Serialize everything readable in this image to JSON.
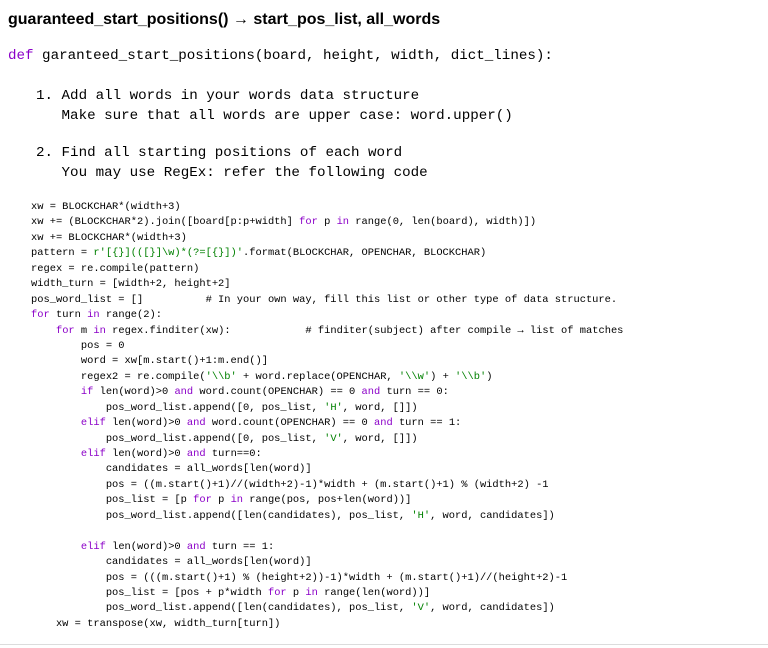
{
  "document": {
    "heading": "guaranteed_start_positions() → start_pos_list, all_words",
    "def_kw": "def",
    "def_signature": " garanteed_start_positions(board, height, width, dict_lines):",
    "steps": [
      {
        "line1": "1. Add all words in your words data structure",
        "line2": "   Make sure that all words are upper case: word.upper()"
      },
      {
        "line1": "2. Find all starting positions of each word",
        "line2": "   You may use RegEx: refer the following code"
      }
    ],
    "code_lines": [
      [
        {
          "t": "xw = BLOCKCHAR*(width+3)"
        }
      ],
      [
        {
          "t": "xw += (BLOCKCHAR*2).join([board[p:p+width] "
        },
        {
          "t": "for",
          "c": "kw"
        },
        {
          "t": " p "
        },
        {
          "t": "in",
          "c": "kw"
        },
        {
          "t": " range(0, len(board), width)])"
        }
      ],
      [
        {
          "t": "xw += BLOCKCHAR*(width+3)"
        }
      ],
      [
        {
          "t": "pattern = "
        },
        {
          "t": "r'[{}](([}]\\w)*(?=[{}])'",
          "c": "str"
        },
        {
          "t": ".format(BLOCKCHAR, OPENCHAR, BLOCKCHAR)"
        }
      ],
      [
        {
          "t": "regex = re.compile(pattern)"
        }
      ],
      [
        {
          "t": "width_turn = [width+2, height+2]"
        }
      ],
      [
        {
          "t": "pos_word_list = []          # In your own way, fill this list or other type of data structure."
        }
      ],
      [
        {
          "t": "for",
          "c": "kw"
        },
        {
          "t": " turn "
        },
        {
          "t": "in",
          "c": "kw"
        },
        {
          "t": " range(2):"
        }
      ],
      [
        {
          "t": "    "
        },
        {
          "t": "for",
          "c": "kw"
        },
        {
          "t": " m "
        },
        {
          "t": "in",
          "c": "kw"
        },
        {
          "t": " regex.finditer(xw):            # finditer(subject) after compile → list of matches"
        }
      ],
      [
        {
          "t": "        pos = 0"
        }
      ],
      [
        {
          "t": "        word = xw[m.start()+1:m.end()]"
        }
      ],
      [
        {
          "t": "        regex2 = re.compile("
        },
        {
          "t": "'\\\\b'",
          "c": "str"
        },
        {
          "t": " + word.replace(OPENCHAR, "
        },
        {
          "t": "'\\\\w'",
          "c": "str"
        },
        {
          "t": ") + "
        },
        {
          "t": "'\\\\b'",
          "c": "str"
        },
        {
          "t": ")"
        }
      ],
      [
        {
          "t": "        "
        },
        {
          "t": "if",
          "c": "kw"
        },
        {
          "t": " len(word)>0 "
        },
        {
          "t": "and",
          "c": "kw"
        },
        {
          "t": " word.count(OPENCHAR) == 0 "
        },
        {
          "t": "and",
          "c": "kw"
        },
        {
          "t": " turn == 0:"
        }
      ],
      [
        {
          "t": "            pos_word_list.append([0, pos_list, "
        },
        {
          "t": "'H'",
          "c": "str"
        },
        {
          "t": ", word, []])"
        }
      ],
      [
        {
          "t": "        "
        },
        {
          "t": "elif",
          "c": "kw"
        },
        {
          "t": " len(word)>0 "
        },
        {
          "t": "and",
          "c": "kw"
        },
        {
          "t": " word.count(OPENCHAR) == 0 "
        },
        {
          "t": "and",
          "c": "kw"
        },
        {
          "t": " turn == 1:"
        }
      ],
      [
        {
          "t": "            pos_word_list.append([0, pos_list, "
        },
        {
          "t": "'V'",
          "c": "str"
        },
        {
          "t": ", word, []])"
        }
      ],
      [
        {
          "t": "        "
        },
        {
          "t": "elif",
          "c": "kw"
        },
        {
          "t": " len(word)>0 "
        },
        {
          "t": "and",
          "c": "kw"
        },
        {
          "t": " turn==0:"
        }
      ],
      [
        {
          "t": "            candidates = all_words[len(word)]"
        }
      ],
      [
        {
          "t": "            pos = ((m.start()+1)//(width+2)-1)*width + (m.start()+1) % (width+2) -1"
        }
      ],
      [
        {
          "t": "            pos_list = [p "
        },
        {
          "t": "for",
          "c": "kw"
        },
        {
          "t": " p "
        },
        {
          "t": "in",
          "c": "kw"
        },
        {
          "t": " range(pos, pos+len(word))]"
        }
      ],
      [
        {
          "t": "            pos_word_list.append([len(candidates), pos_list, "
        },
        {
          "t": "'H'",
          "c": "str"
        },
        {
          "t": ", word, candidates])"
        }
      ],
      [
        {
          "t": ""
        }
      ],
      [
        {
          "t": "        "
        },
        {
          "t": "elif",
          "c": "kw"
        },
        {
          "t": " len(word)>0 "
        },
        {
          "t": "and",
          "c": "kw"
        },
        {
          "t": " turn == 1:"
        }
      ],
      [
        {
          "t": "            candidates = all_words[len(word)]"
        }
      ],
      [
        {
          "t": "            pos = (((m.start()+1) % (height+2))-1)*width + (m.start()+1)//(height+2)-1"
        }
      ],
      [
        {
          "t": "            pos_list = [pos + p*width "
        },
        {
          "t": "for",
          "c": "kw"
        },
        {
          "t": " p "
        },
        {
          "t": "in",
          "c": "kw"
        },
        {
          "t": " range(len(word))]"
        }
      ],
      [
        {
          "t": "            pos_word_list.append([len(candidates), pos_list, "
        },
        {
          "t": "'V'",
          "c": "str"
        },
        {
          "t": ", word, candidates])"
        }
      ],
      [
        {
          "t": "    xw = transpose(xw, width_turn[turn])"
        }
      ]
    ],
    "colors": {
      "keyword": "#8b00c8",
      "string": "#008000",
      "text": "#000000"
    }
  }
}
